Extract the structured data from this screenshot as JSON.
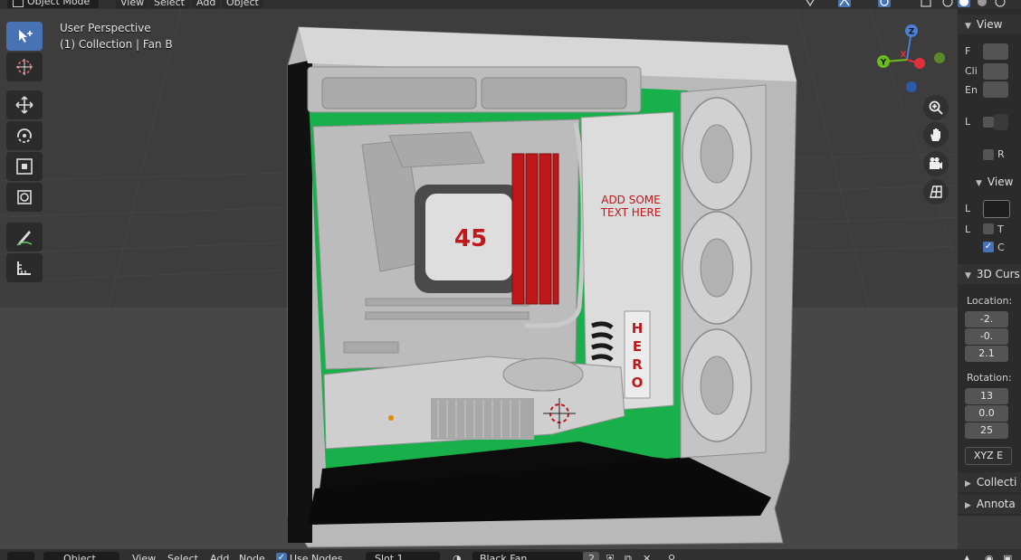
{
  "header": {
    "mode": "Object Mode",
    "menus": [
      "View",
      "Select",
      "Add",
      "Object"
    ]
  },
  "viewport": {
    "perspective_label": "User Perspective",
    "collection_label": "(1) Collection | Fan B",
    "scene_text": {
      "panel_text": "ADD SOME TEXT HERE",
      "vertical_text": "HERO",
      "cooler_number": "45"
    },
    "gizmo": {
      "z": "Z",
      "y": "Y",
      "x": "X"
    },
    "colors": {
      "green": "#17b04a",
      "red": "#c0171b",
      "case": "#cdcdcd",
      "background": "#3d3d3d"
    }
  },
  "toolbar": {
    "tools": [
      "select-box",
      "cursor",
      "move",
      "rotate",
      "scale",
      "transform",
      "annotate",
      "measure"
    ],
    "active": "select-box"
  },
  "sidebar": {
    "view_panel": "View",
    "clip_labels": [
      "F",
      "Cli",
      "En"
    ],
    "local_camera": "L",
    "render_region": "R",
    "view_lock": {
      "header": "View",
      "row1": "L",
      "row2": "L",
      "t": "T",
      "c": "C"
    },
    "cursor_panel": "3D Curs",
    "location_label": "Location:",
    "location": [
      "-2.",
      "-0.",
      "2.1"
    ],
    "rotation_label": "Rotation:",
    "rotation": [
      "13",
      "0.0",
      "25"
    ],
    "rotation_mode": "XYZ E",
    "collections_panel": "Collecti",
    "annotations_panel": "Annota"
  },
  "footer": {
    "editor": "Object",
    "menus": [
      "View",
      "Select",
      "Add",
      "Node"
    ],
    "use_nodes": "Use Nodes",
    "slot": "Slot 1",
    "material": "Black Fan",
    "users": "2"
  }
}
